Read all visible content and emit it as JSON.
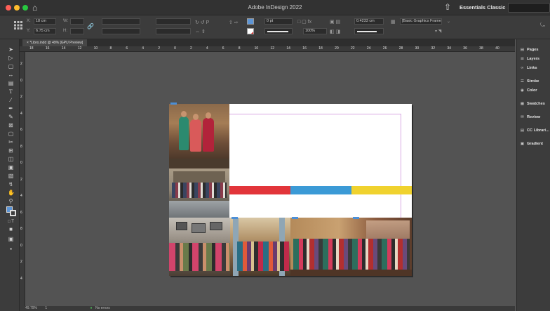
{
  "app": {
    "title": "Adobe InDesign 2022",
    "workspace": "Essentials Classic ⌄"
  },
  "control_panel": {
    "x_value": "18 cm",
    "y_value": "6.75 cm",
    "stroke_weight": "0 pt",
    "opacity": "100%",
    "offset_value": "0.4233 cm",
    "object_style": "[Basic Graphics Frame]+"
  },
  "document_tab": {
    "label": "*Libro.indd @ 49% [GPU Preview]",
    "close": "×"
  },
  "ruler": {
    "h_ticks": [
      "18",
      "16",
      "14",
      "12",
      "10",
      "8",
      "6",
      "4",
      "2",
      "0",
      "2",
      "4",
      "6",
      "8",
      "10",
      "12",
      "14",
      "16",
      "18",
      "20",
      "22",
      "24",
      "26",
      "28",
      "30",
      "32",
      "34",
      "36",
      "38",
      "40"
    ],
    "v_ticks": [
      "2",
      "0",
      "2",
      "4",
      "6",
      "8",
      "0",
      "2",
      "4",
      "6",
      "8",
      "0",
      "2",
      "4"
    ]
  },
  "panels": {
    "items": [
      "Pages",
      "Layers",
      "Links",
      "Stroke",
      "Color",
      "Swatches",
      "Review",
      "CC Librari...",
      "Gradient"
    ]
  },
  "status": {
    "zoom": "49.79%",
    "page": "1",
    "preflight": "No errors"
  },
  "colors": {
    "bar_red": "#e2353a",
    "bar_blue": "#3b9ad6",
    "bar_yellow": "#f0d22e",
    "selection_blue": "#4c8fd6"
  },
  "icons": [
    "home-icon",
    "share-icon",
    "selection-icon",
    "direct-selection-icon",
    "page-icon",
    "gap-icon",
    "type-icon",
    "line-icon",
    "pen-icon",
    "pencil-icon",
    "rectangle-frame-icon",
    "rectangle-icon",
    "scissors-icon",
    "free-transform-icon",
    "gradient-icon",
    "note-icon",
    "eyedropper-icon",
    "hand-icon",
    "zoom-icon",
    "fill-stroke-icon",
    "pages-icon",
    "layers-icon",
    "links-icon",
    "stroke-icon",
    "color-icon",
    "swatches-icon",
    "review-icon",
    "cc-libraries-icon",
    "gradient-panel-icon"
  ]
}
